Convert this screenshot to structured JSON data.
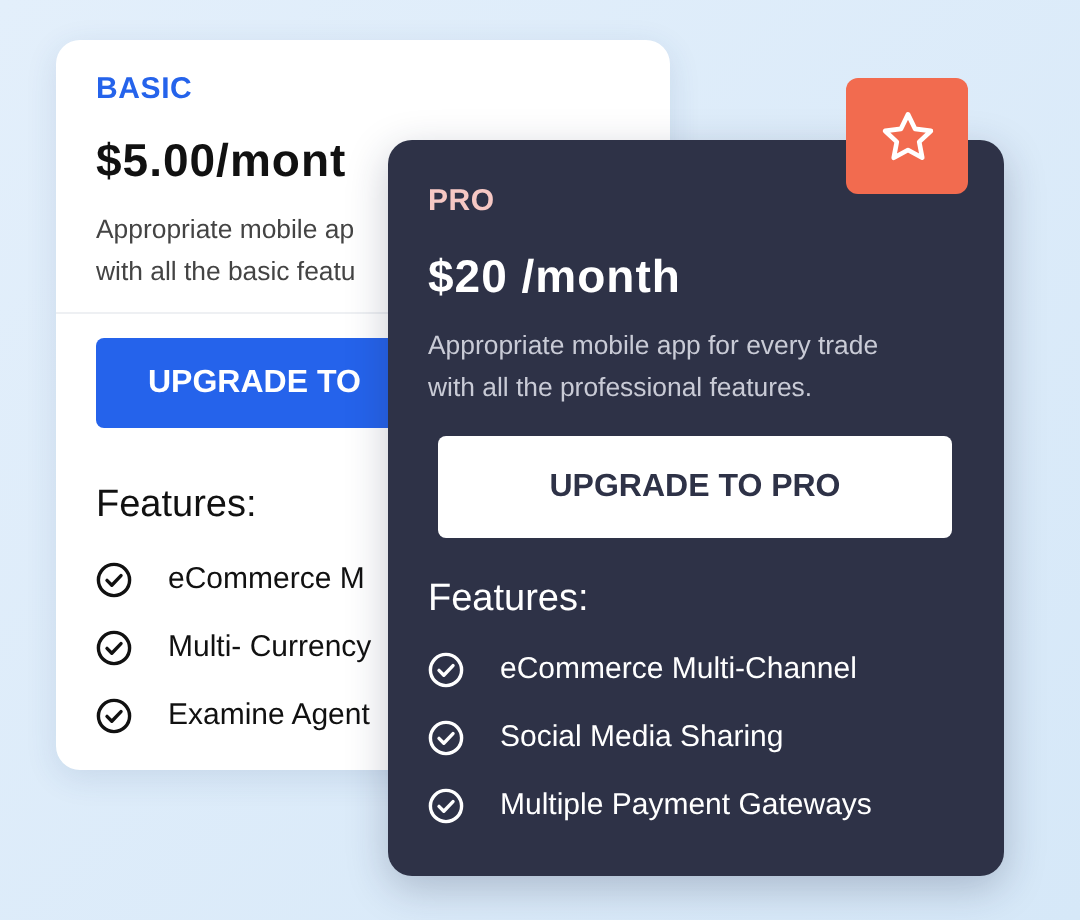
{
  "plans": [
    {
      "kind": "basic",
      "name": "BASIC",
      "price": "$5.00/mont",
      "description": [
        "Appropriate mobile ap",
        "with all the basic featu"
      ],
      "button": "UPGRADE TO",
      "features_title": "Features:",
      "features": [
        "eCommerce M",
        "Multi- Currency",
        "Examine Agent"
      ]
    },
    {
      "kind": "pro",
      "name": "PRO",
      "price": "$20 /month",
      "description": [
        "Appropriate mobile app for every trade",
        "with all the professional features."
      ],
      "button": "UPGRADE TO PRO",
      "features_title": "Features:",
      "features": [
        "eCommerce Multi-Channel",
        "Social Media Sharing",
        "Multiple Payment Gateways"
      ]
    }
  ]
}
